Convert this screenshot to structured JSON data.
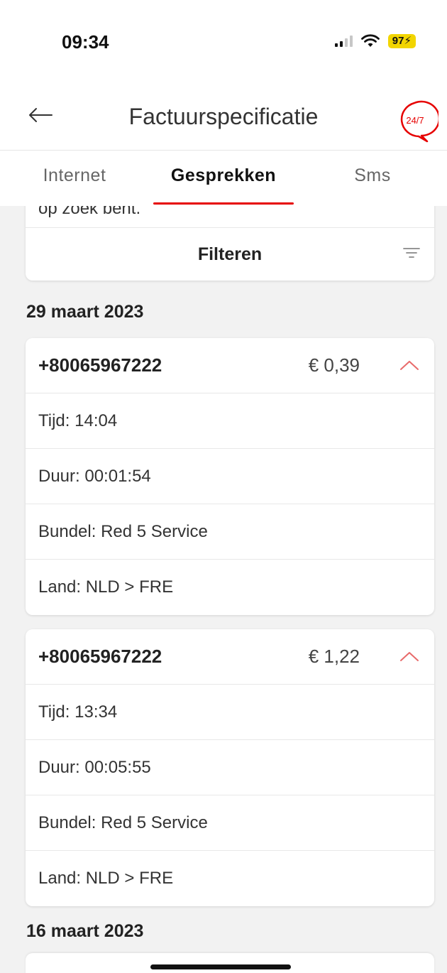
{
  "status_bar": {
    "time": "09:34",
    "battery": "97"
  },
  "header": {
    "title": "Factuurspecificatie",
    "back_icon": "arrow-left-icon",
    "help_icon": "chat-24-7-icon",
    "help_label": "24/7",
    "accent_color": "#e60000"
  },
  "tabs": [
    {
      "label": "Internet",
      "active": false
    },
    {
      "label": "Gesprekken",
      "active": true
    },
    {
      "label": "Sms",
      "active": false
    }
  ],
  "filter": {
    "intro_text_fragment": "op zoek bent.",
    "label": "Filteren",
    "icon": "filter-lines-icon"
  },
  "groups": [
    {
      "date": "29 maart 2023",
      "calls": [
        {
          "number": "+80065967222",
          "price": "€ 0,39",
          "expanded": true,
          "details": [
            "Tijd: 14:04",
            "Duur: 00:01:54",
            "Bundel: Red 5 Service",
            "Land: NLD > FRE"
          ]
        },
        {
          "number": "+80065967222",
          "price": "€ 1,22",
          "expanded": true,
          "details": [
            "Tijd: 13:34",
            "Duur: 00:05:55",
            "Bundel: Red 5 Service",
            "Land: NLD > FRE"
          ]
        }
      ]
    },
    {
      "date": "16 maart 2023",
      "calls": []
    }
  ]
}
